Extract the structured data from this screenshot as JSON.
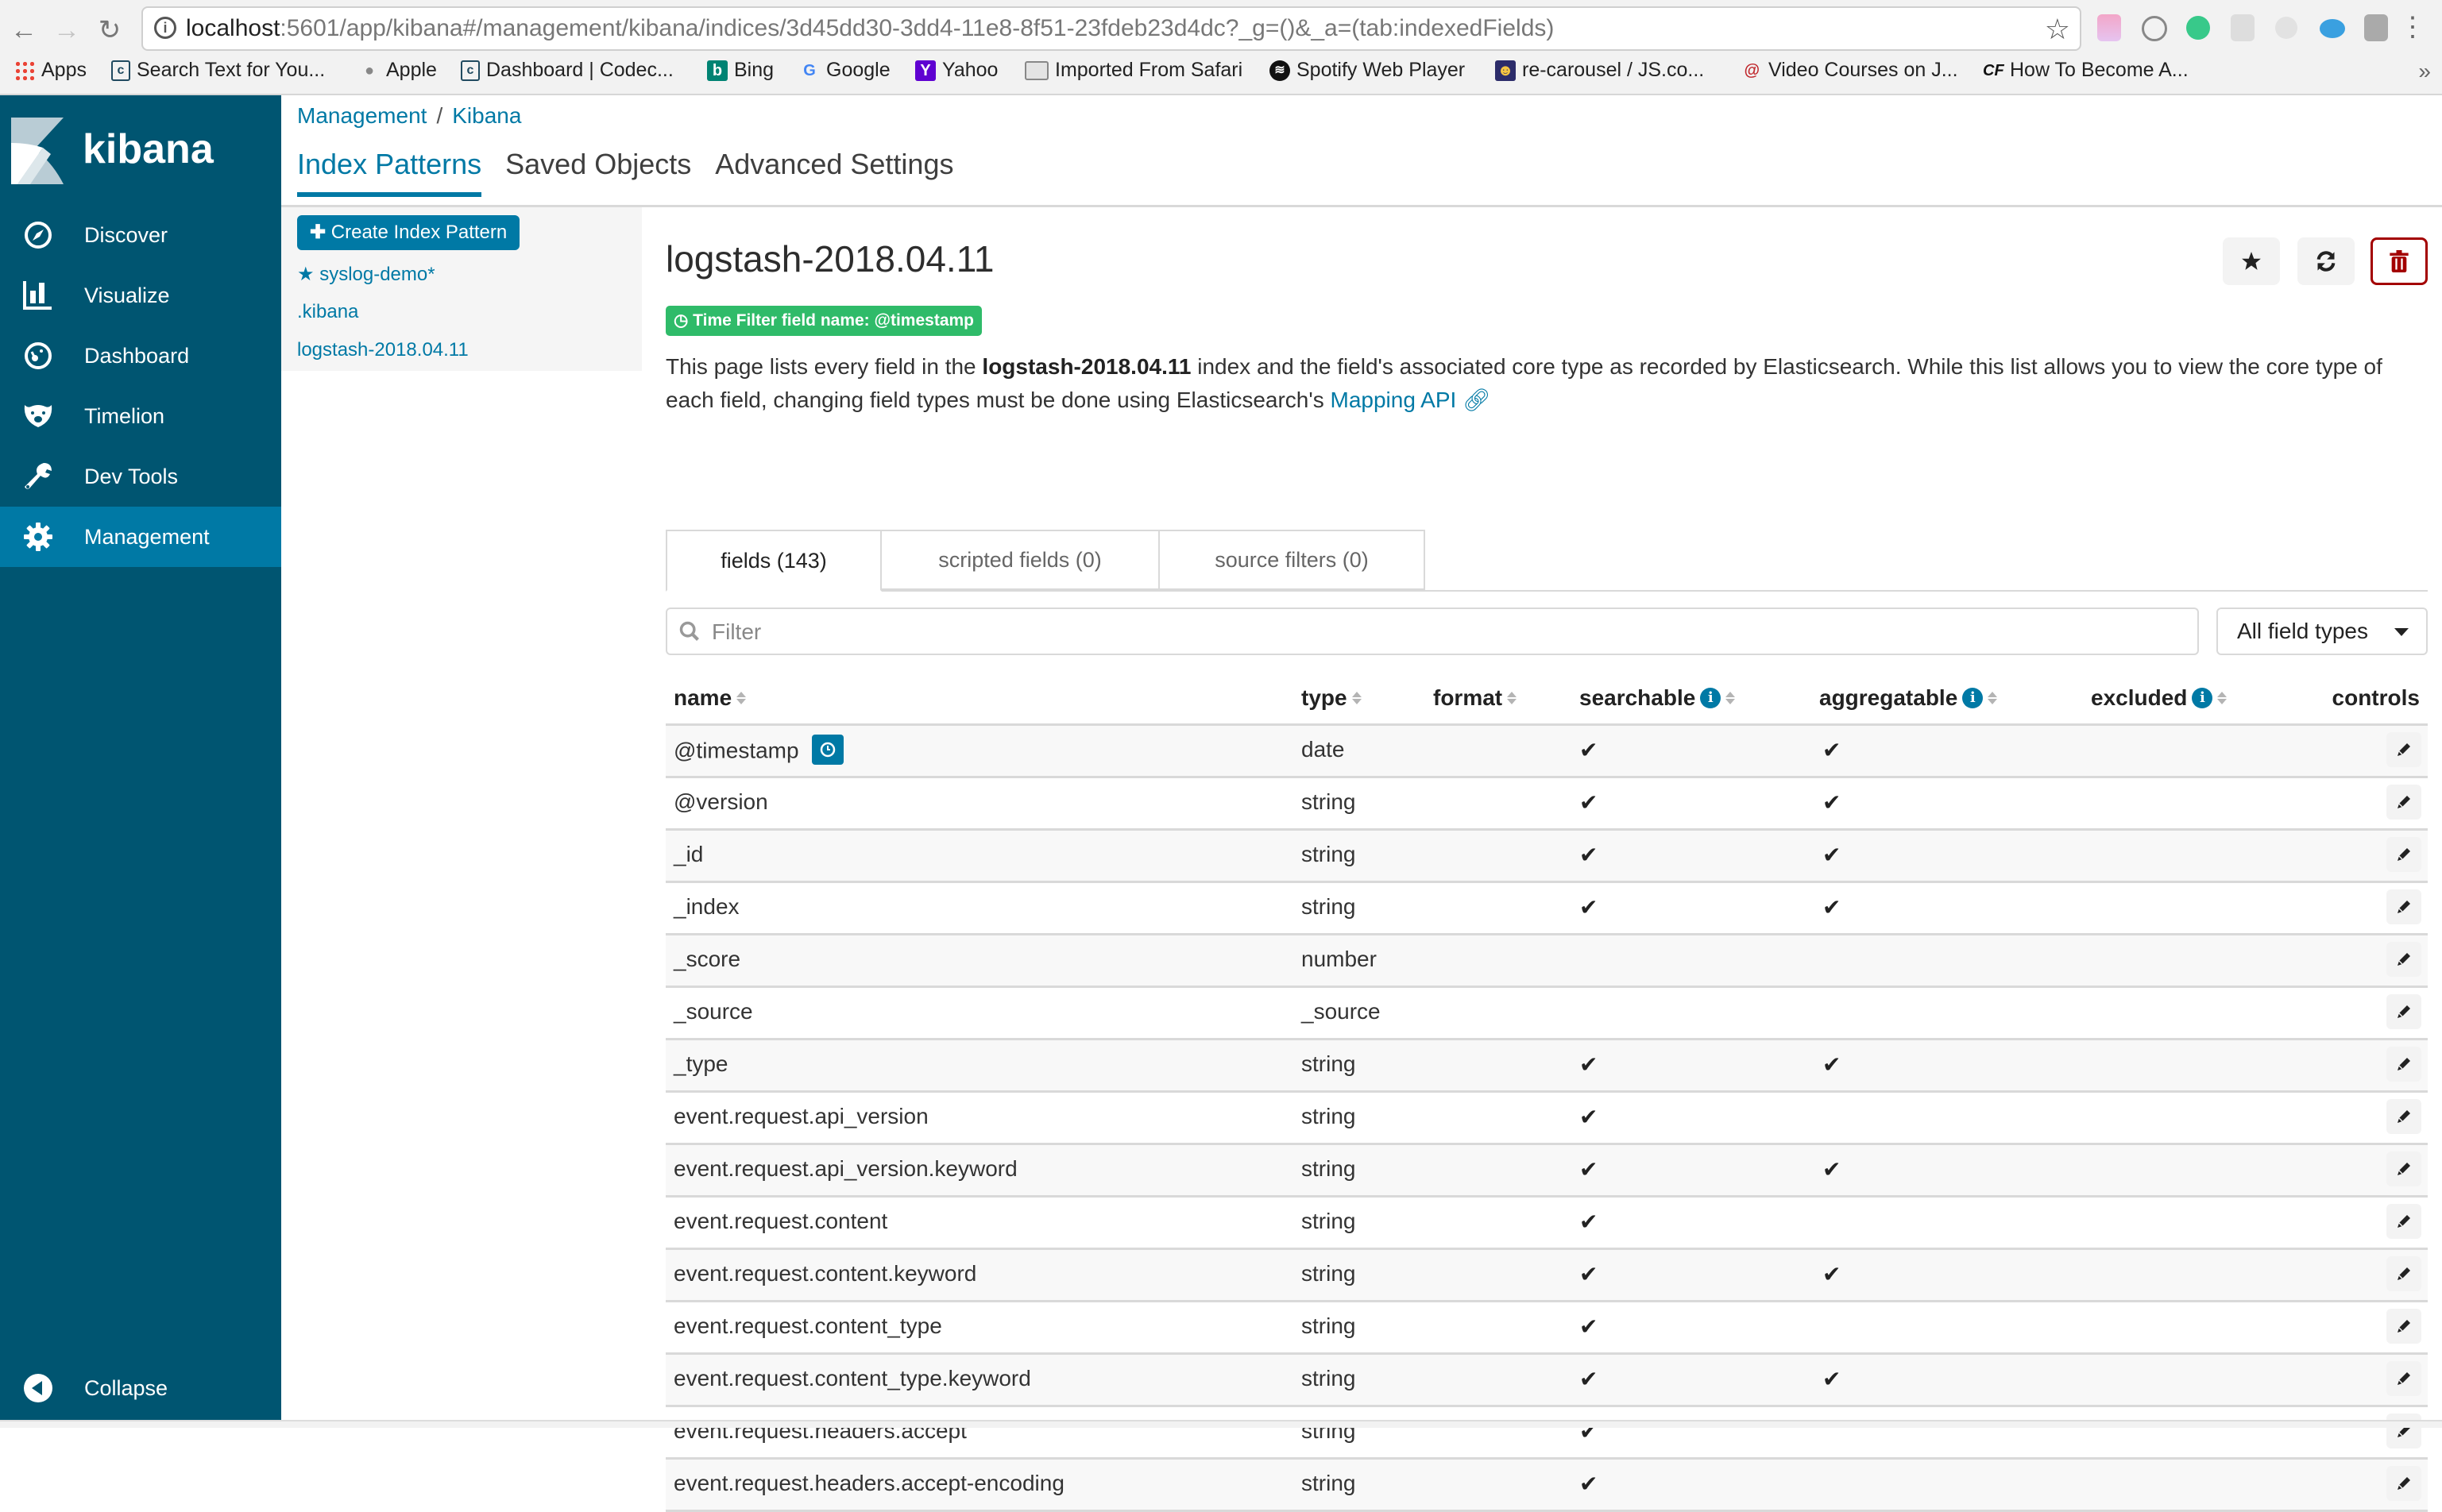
{
  "browser": {
    "url_host": "localhost",
    "url_rest": ":5601/app/kibana#/management/kibana/indices/3d45dd30-3dd4-11e8-8f51-23fdeb23d4dc?_g=()&_a=(tab:indexedFields)",
    "bookmarks": [
      {
        "label": "Apps",
        "icon": "apps-grid-icon"
      },
      {
        "label": "Search Text for You...",
        "icon": "codecademy-icon"
      },
      {
        "label": "Apple",
        "icon": "apple-icon"
      },
      {
        "label": "Dashboard | Codec...",
        "icon": "codecademy-icon"
      },
      {
        "label": "Bing",
        "icon": "bing-icon"
      },
      {
        "label": "Google",
        "icon": "google-icon"
      },
      {
        "label": "Yahoo",
        "icon": "yahoo-icon"
      },
      {
        "label": "Imported From Safari",
        "icon": "folder-icon"
      },
      {
        "label": "Spotify Web Player",
        "icon": "spotify-icon"
      },
      {
        "label": "re-carousel / JS.co...",
        "icon": "jsco-icon"
      },
      {
        "label": "Video Courses on J...",
        "icon": "video-courses-icon"
      },
      {
        "label": "How To Become A...",
        "icon": "cf-icon"
      }
    ],
    "more_bookmarks": "»"
  },
  "sidebar": {
    "logo_text": "kibana",
    "items": [
      {
        "label": "Discover",
        "icon": "compass-icon"
      },
      {
        "label": "Visualize",
        "icon": "bar-chart-icon"
      },
      {
        "label": "Dashboard",
        "icon": "dashboard-gauge-icon"
      },
      {
        "label": "Timelion",
        "icon": "timelion-bear-icon"
      },
      {
        "label": "Dev Tools",
        "icon": "wrench-icon"
      },
      {
        "label": "Management",
        "icon": "gear-icon",
        "active": true
      }
    ],
    "collapse_label": "Collapse"
  },
  "header": {
    "breadcrumb": [
      "Management",
      "Kibana"
    ],
    "breadcrumb_sep": "/",
    "tabs": [
      {
        "label": "Index Patterns",
        "active": true
      },
      {
        "label": "Saved Objects"
      },
      {
        "label": "Advanced Settings"
      }
    ]
  },
  "index_list": {
    "create_label": "Create Index Pattern",
    "patterns": [
      {
        "label": "syslog-demo*",
        "default": true
      },
      {
        "label": ".kibana"
      },
      {
        "label": "logstash-2018.04.11"
      }
    ]
  },
  "detail": {
    "title": "logstash-2018.04.11",
    "time_filter_badge": "Time Filter field name: @timestamp",
    "desc_part1": "This page lists every field in the ",
    "desc_bold": "logstash-2018.04.11",
    "desc_part2": " index and the field's associated core type as recorded by Elasticsearch. While this list allows you to view the core type of each field, changing field types must be done using Elasticsearch's ",
    "desc_link": "Mapping API",
    "sub_tabs": [
      {
        "label": "fields (143)",
        "active": true
      },
      {
        "label": "scripted fields (0)"
      },
      {
        "label": "source filters (0)"
      }
    ],
    "filter_placeholder": "Filter",
    "filter_value": "",
    "type_select": "All field types"
  },
  "table": {
    "columns": {
      "name": "name",
      "type": "type",
      "format": "format",
      "searchable": "searchable",
      "aggregatable": "aggregatable",
      "excluded": "excluded",
      "controls": "controls"
    },
    "check_glyph": "✔",
    "rows": [
      {
        "name": "@timestamp",
        "type": "date",
        "searchable": true,
        "aggregatable": true,
        "time_field": true
      },
      {
        "name": "@version",
        "type": "string",
        "searchable": true,
        "aggregatable": true
      },
      {
        "name": "_id",
        "type": "string",
        "searchable": true,
        "aggregatable": true
      },
      {
        "name": "_index",
        "type": "string",
        "searchable": true,
        "aggregatable": true
      },
      {
        "name": "_score",
        "type": "number",
        "searchable": false,
        "aggregatable": false
      },
      {
        "name": "_source",
        "type": "_source",
        "searchable": false,
        "aggregatable": false
      },
      {
        "name": "_type",
        "type": "string",
        "searchable": true,
        "aggregatable": true
      },
      {
        "name": "event.request.api_version",
        "type": "string",
        "searchable": true,
        "aggregatable": false
      },
      {
        "name": "event.request.api_version.keyword",
        "type": "string",
        "searchable": true,
        "aggregatable": true
      },
      {
        "name": "event.request.content",
        "type": "string",
        "searchable": true,
        "aggregatable": false
      },
      {
        "name": "event.request.content.keyword",
        "type": "string",
        "searchable": true,
        "aggregatable": true
      },
      {
        "name": "event.request.content_type",
        "type": "string",
        "searchable": true,
        "aggregatable": false
      },
      {
        "name": "event.request.content_type.keyword",
        "type": "string",
        "searchable": true,
        "aggregatable": true
      },
      {
        "name": "event.request.headers.accept",
        "type": "string",
        "searchable": true,
        "aggregatable": false
      },
      {
        "name": "event.request.headers.accept-encoding",
        "type": "string",
        "searchable": true,
        "aggregatable": false
      }
    ]
  },
  "colors": {
    "sidebar_bg": "#005571",
    "sidebar_active": "#0079a5",
    "accent": "#0079a5",
    "success": "#2fbb69",
    "danger": "#a30000"
  }
}
